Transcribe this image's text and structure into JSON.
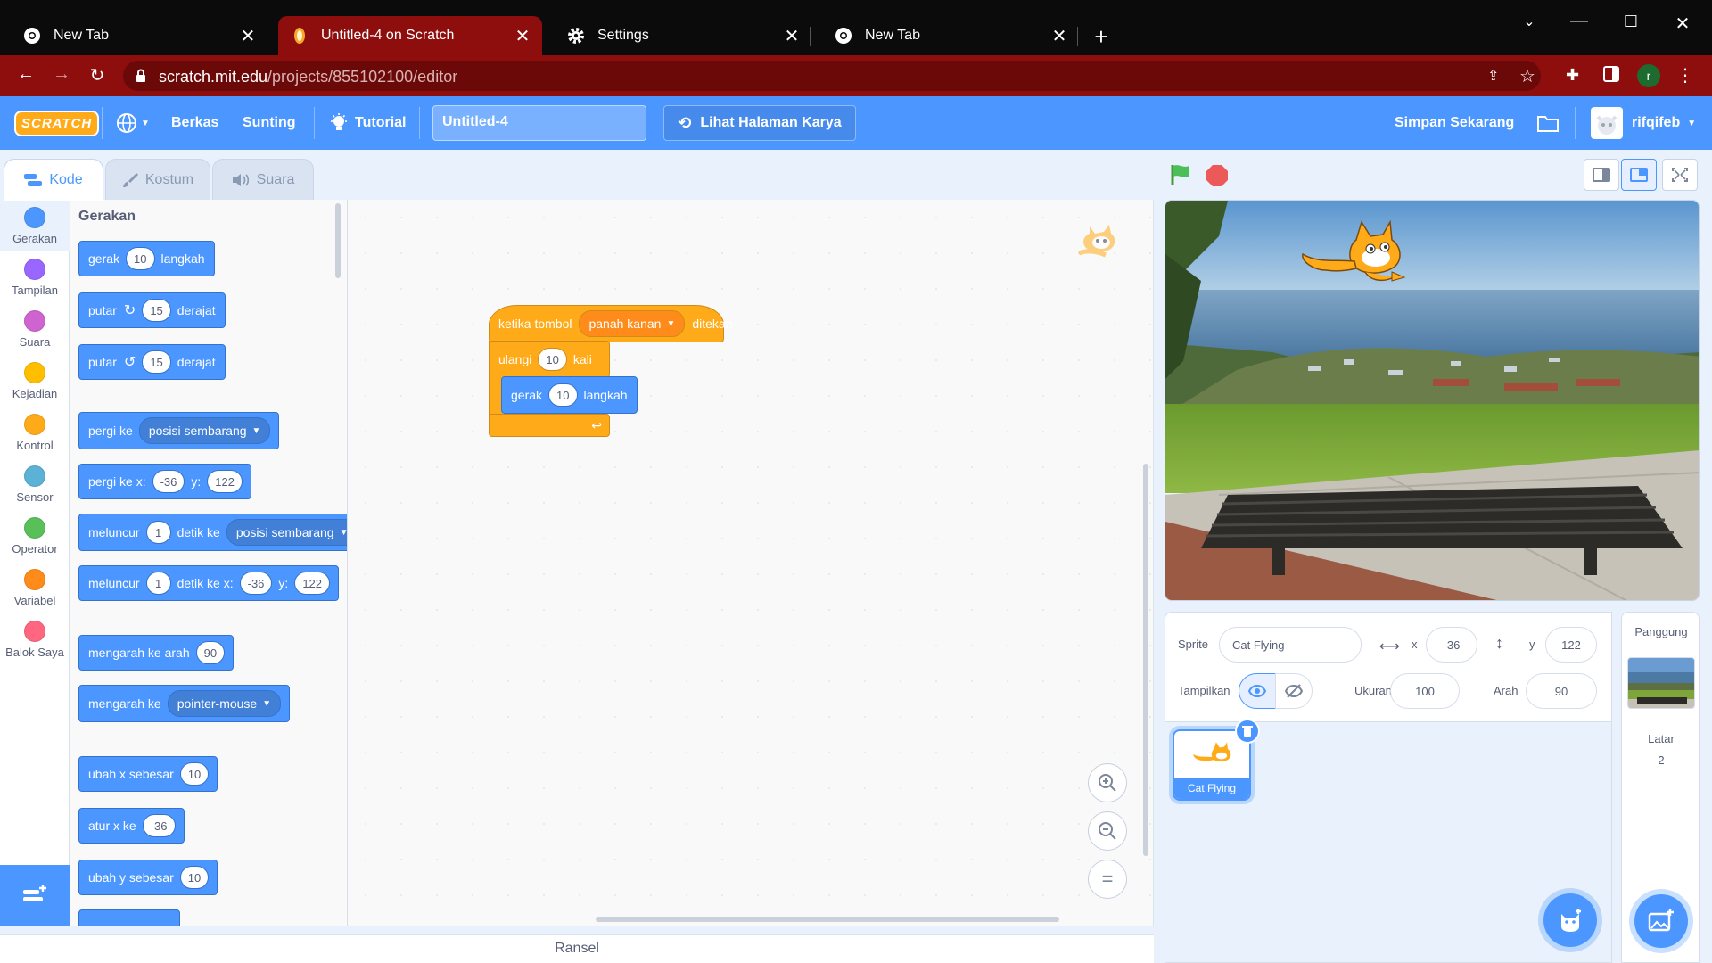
{
  "browser": {
    "tabs": [
      {
        "title": "New Tab",
        "icon": "chrome-icon"
      },
      {
        "title": "Untitled-4 on Scratch",
        "icon": "scratch-favicon"
      },
      {
        "title": "Settings",
        "icon": "gear-icon"
      },
      {
        "title": "New Tab",
        "icon": "chrome-icon"
      }
    ],
    "active_tab": 1,
    "url_host": "scratch.mit.edu",
    "url_path": "/projects/855102100/editor",
    "profile_initial": "r",
    "colors": {
      "frame": "#0b0b0b",
      "accent": "#8e0d0d"
    }
  },
  "menu": {
    "logo": "SCRATCH",
    "file": "Berkas",
    "edit": "Sunting",
    "tutorial": "Tutorial",
    "project_title": "Untitled-4",
    "see_project": "Lihat Halaman Karya",
    "save_now": "Simpan Sekarang",
    "username": "rifqifeb",
    "color": "#4c97ff"
  },
  "editor_tabs": {
    "code": "Kode",
    "costumes": "Kostum",
    "sounds": "Suara"
  },
  "categories": [
    {
      "label": "Gerakan",
      "color": "#4c97ff"
    },
    {
      "label": "Tampilan",
      "color": "#9966ff"
    },
    {
      "label": "Suara",
      "color": "#cf63cf"
    },
    {
      "label": "Kejadian",
      "color": "#ffbf00"
    },
    {
      "label": "Kontrol",
      "color": "#ffab19"
    },
    {
      "label": "Sensor",
      "color": "#5cb1d6"
    },
    {
      "label": "Operator",
      "color": "#59c059"
    },
    {
      "label": "Variabel",
      "color": "#ff8c1a"
    },
    {
      "label": "Balok Saya",
      "color": "#ff6680"
    }
  ],
  "palette": {
    "heading": "Gerakan",
    "move": {
      "a": "gerak",
      "v": "10",
      "b": "langkah"
    },
    "turn_right": {
      "a": "putar",
      "v": "15",
      "b": "derajat"
    },
    "turn_left": {
      "a": "putar",
      "v": "15",
      "b": "derajat"
    },
    "goto": {
      "a": "pergi ke",
      "dd": "posisi sembarang"
    },
    "goto_xy": {
      "a": "pergi ke x:",
      "x": "-36",
      "b": "y:",
      "y": "122"
    },
    "glide": {
      "a": "meluncur",
      "v": "1",
      "b": "detik ke",
      "dd": "posisi sembarang"
    },
    "glide_xy": {
      "a": "meluncur",
      "v": "1",
      "b": "detik ke x:",
      "x": "-36",
      "c": "y:",
      "y": "122"
    },
    "point_dir": {
      "a": "mengarah ke arah",
      "v": "90"
    },
    "point_towards": {
      "a": "mengarah ke",
      "dd": "pointer-mouse"
    },
    "change_x": {
      "a": "ubah x sebesar",
      "v": "10"
    },
    "set_x": {
      "a": "atur x ke",
      "v": "-36"
    },
    "change_y": {
      "a": "ubah y sebesar",
      "v": "10"
    }
  },
  "script": {
    "hat": {
      "a": "ketika tombol",
      "dd": "panah kanan",
      "b": "ditekan"
    },
    "repeat": {
      "a": "ulangi",
      "v": "10",
      "b": "kali"
    },
    "move": {
      "a": "gerak",
      "v": "10",
      "b": "langkah"
    }
  },
  "backpack": "Ransel",
  "sprite_info": {
    "sprite_label": "Sprite",
    "sprite_name": "Cat Flying",
    "x_label": "x",
    "x": "-36",
    "y_label": "y",
    "y": "122",
    "show_label": "Tampilkan",
    "size_label": "Ukuran",
    "size": "100",
    "direction_label": "Arah",
    "direction": "90"
  },
  "sprites": [
    {
      "name": "Cat Flying"
    }
  ],
  "stage_panel": {
    "title": "Panggung",
    "backdrops_label": "Latar",
    "backdrops_count": "2"
  }
}
